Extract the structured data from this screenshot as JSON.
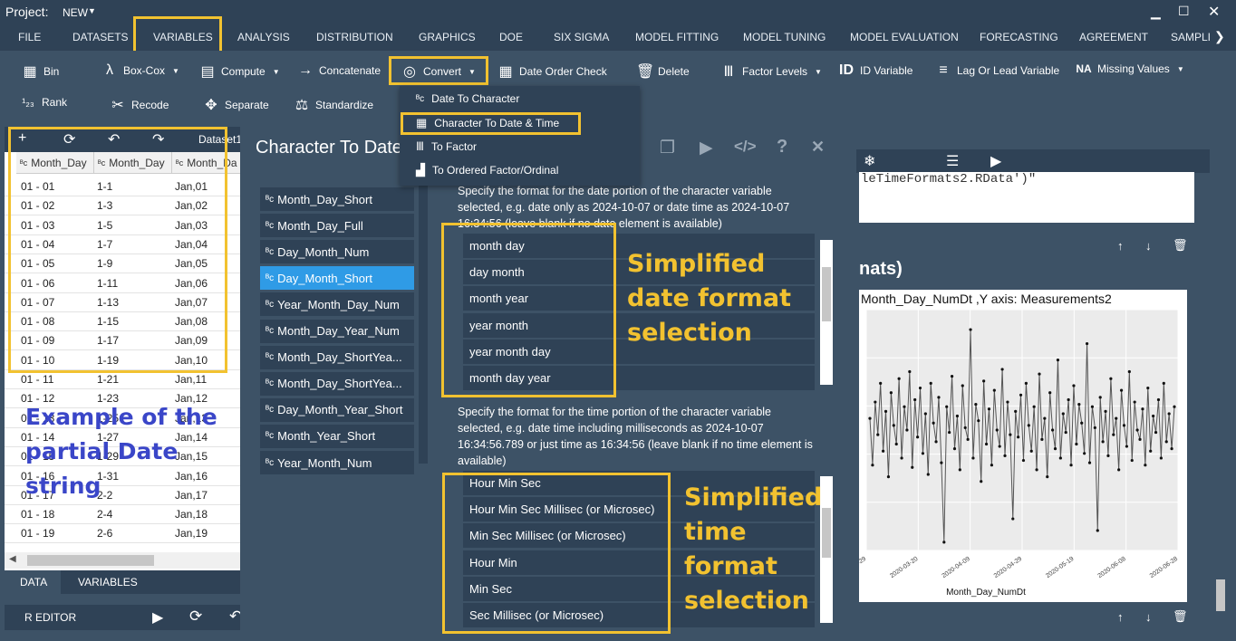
{
  "window": {
    "project_label": "Project:",
    "project_name": "NEW"
  },
  "menu": {
    "tabs": [
      "FILE",
      "DATASETS",
      "VARIABLES",
      "ANALYSIS",
      "DISTRIBUTION",
      "GRAPHICS",
      "DOE",
      "SIX SIGMA",
      "MODEL FITTING",
      "MODEL TUNING",
      "MODEL EVALUATION",
      "FORECASTING",
      "AGREEMENT",
      "SAMPLI"
    ],
    "active": "VARIABLES"
  },
  "toolbar": {
    "row1": [
      "Bin",
      "Box-Cox",
      "Compute",
      "Concatenate",
      "Convert",
      "Date Order Check",
      "Delete",
      "Factor Levels",
      "ID Variable",
      "Lag Or Lead Variable",
      "Missing Values"
    ],
    "row2": [
      "Rank",
      "Recode",
      "Separate",
      "Standardize"
    ]
  },
  "convert_menu": {
    "items": [
      "Date To Character",
      "Character To Date & Time",
      "To Factor",
      "To Ordered Factor/Ordinal"
    ],
    "highlighted": "Character To Date & Time"
  },
  "data_panel": {
    "dataset_label": "Dataset1",
    "columns": [
      "Month_Day",
      "Month_Day",
      "Month_Da"
    ],
    "rows": [
      [
        "01 - 01",
        "1-1",
        "Jan,01"
      ],
      [
        "01 - 02",
        "1-3",
        "Jan,02"
      ],
      [
        "01 - 03",
        "1-5",
        "Jan,03"
      ],
      [
        "01 - 04",
        "1-7",
        "Jan,04"
      ],
      [
        "01 - 05",
        "1-9",
        "Jan,05"
      ],
      [
        "01 - 06",
        "1-11",
        "Jan,06"
      ],
      [
        "01 - 07",
        "1-13",
        "Jan,07"
      ],
      [
        "01 - 08",
        "1-15",
        "Jan,08"
      ],
      [
        "01 - 09",
        "1-17",
        "Jan,09"
      ],
      [
        "01 - 10",
        "1-19",
        "Jan,10"
      ],
      [
        "01 - 11",
        "1-21",
        "Jan,11"
      ],
      [
        "01 - 12",
        "1-23",
        "Jan,12"
      ],
      [
        "01 - 13",
        "1-25",
        "Jan,13"
      ],
      [
        "01 - 14",
        "1-27",
        "Jan,14"
      ],
      [
        "01 - 15",
        "1-29",
        "Jan,15"
      ],
      [
        "01 - 16",
        "1-31",
        "Jan,16"
      ],
      [
        "01 - 17",
        "2-2",
        "Jan,17"
      ],
      [
        "01 - 18",
        "2-4",
        "Jan,18"
      ],
      [
        "01 - 19",
        "2-6",
        "Jan,19"
      ]
    ],
    "tabs": [
      "DATA",
      "VARIABLES"
    ],
    "r_editor": "R EDITOR"
  },
  "dialog": {
    "title": "Character To Date",
    "variables": [
      "Month_Day_Short",
      "Month_Day_Full",
      "Day_Month_Num",
      "Day_Month_Short",
      "Year_Month_Day_Num",
      "Month_Day_Year_Num",
      "Month_Day_ShortYea...",
      "Month_Day_ShortYea...",
      "Day_Month_Year_Short",
      "Month_Year_Short",
      "Year_Month_Num"
    ],
    "selected_variable": "Day_Month_Short",
    "date_desc": "Specify the format for the date portion of the character variable selected, e.g. date only as 2024-10-07 or date time as 2024-10-07 16:34:56 (leave blank if no date element is available)",
    "date_formats": [
      "month day",
      "day month",
      "month year",
      "year month",
      "year month day",
      "month day year"
    ],
    "time_desc": "Specify the format for the time portion of the character variable selected, e.g. date time including milliseconds as 2024-10-07 16:34:56.789 or just time as 16:34:56 (leave blank if no time element is available)",
    "time_formats": [
      "Hour Min Sec",
      "Hour Min Sec Millisec (or Microsec)",
      "Min Sec Millisec (or Microsec)",
      "Hour Min",
      "Min Sec",
      "Sec Millisec (or Microsec)"
    ]
  },
  "annotations": {
    "date": "Simplified date format selection",
    "time": "Simplified time format selection",
    "example": "Example of the partial Date string"
  },
  "right_panel": {
    "code": "leTimeFormats2.RData')\"",
    "heading": "nats)",
    "plot_title": "Month_Day_NumDt ,Y axis: Measurements2",
    "x_label": "Month_Day_NumDt"
  },
  "chart_data": {
    "type": "line",
    "title": "Month_Day_NumDt ,Y axis: Measurements2",
    "xlabel": "Month_Day_NumDt",
    "x_ticks": [
      "2020-02-29",
      "2020-03-20",
      "2020-04-09",
      "2020-04-29",
      "2020-05-19",
      "2020-06-08",
      "2020-06-28"
    ],
    "values": [
      0.55,
      0.35,
      0.62,
      0.48,
      0.7,
      0.41,
      0.58,
      0.3,
      0.66,
      0.52,
      0.44,
      0.72,
      0.38,
      0.6,
      0.5,
      0.75,
      0.34,
      0.63,
      0.47,
      0.68,
      0.4,
      0.57,
      0.31,
      0.7,
      0.53,
      0.45,
      0.64,
      0.36,
      0.02,
      0.6,
      0.49,
      0.73,
      0.42,
      0.56,
      0.33,
      0.69,
      0.51,
      0.46,
      0.93,
      0.38,
      0.61,
      0.54,
      0.28,
      0.71,
      0.44,
      0.59,
      0.35,
      0.67,
      0.5,
      0.43,
      0.76,
      0.39,
      0.62,
      0.48,
      0.12,
      0.58,
      0.47,
      0.65,
      0.37,
      0.7,
      0.52,
      0.41,
      0.6,
      0.33,
      0.74,
      0.46,
      0.55,
      0.3,
      0.66,
      0.5,
      0.42,
      0.8,
      0.38,
      0.57,
      0.49,
      0.63,
      0.35,
      0.69,
      0.44,
      0.61,
      0.53,
      0.4,
      0.87,
      0.36,
      0.6,
      0.51,
      0.07,
      0.64,
      0.45,
      0.58,
      0.39,
      0.72,
      0.48,
      0.55,
      0.33,
      0.67,
      0.52,
      0.43,
      0.75,
      0.37,
      0.62,
      0.5,
      0.46,
      0.59,
      0.35,
      0.68,
      0.41,
      0.56,
      0.49,
      0.63,
      0.38,
      0.7,
      0.45,
      0.57,
      0.42,
      0.6
    ]
  }
}
